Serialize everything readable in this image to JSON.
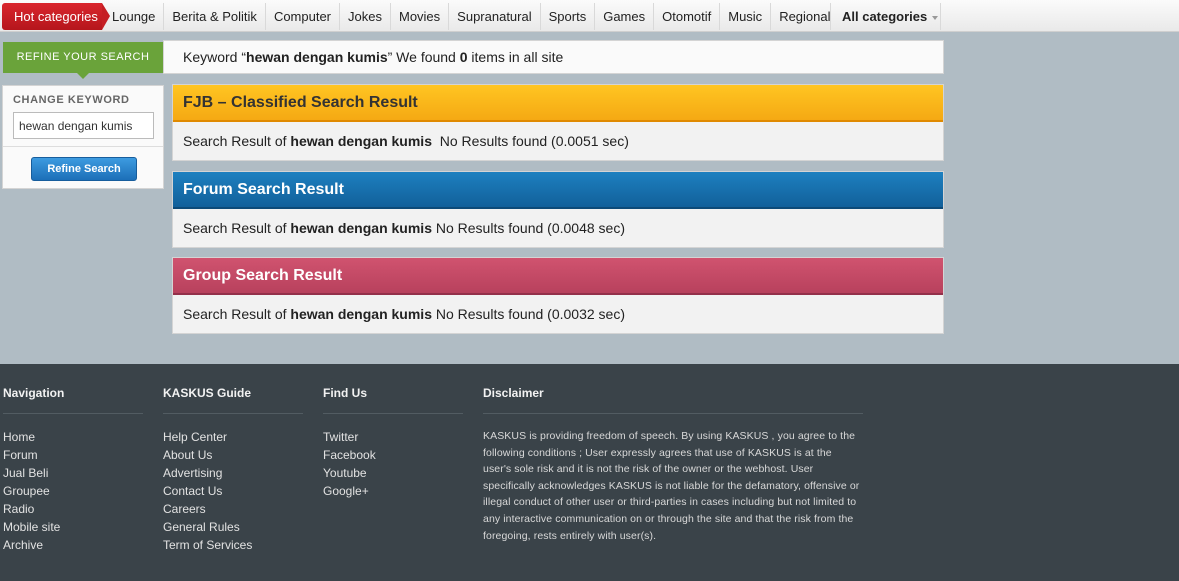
{
  "nav": {
    "hot_label": "Hot categories",
    "items": [
      "Lounge",
      "Berita & Politik",
      "Computer",
      "Jokes",
      "Movies",
      "Supranatural",
      "Sports",
      "Games",
      "Otomotif",
      "Music",
      "Regional"
    ],
    "all_categories": "All categories"
  },
  "refine": {
    "tab_label": "REFINE YOUR SEARCH",
    "change_label": "CHANGE KEYWORD",
    "keyword_value": "hewan dengan kumis",
    "button_label": "Refine Search"
  },
  "summary": {
    "prefix": "Keyword “",
    "keyword": "hewan dengan kumis",
    "middle": "” We found ",
    "count": "0",
    "suffix": " items in all site"
  },
  "panels": [
    {
      "title": "FJB – Classified Search Result",
      "prefix": "Search Result of ",
      "keyword": "hewan dengan kumis",
      "status": "  No Results found (0.0051 sec)"
    },
    {
      "title": "Forum Search Result",
      "prefix": "Search Result of ",
      "keyword": "hewan dengan kumis",
      "status": " No Results found (0.0048 sec)"
    },
    {
      "title": "Group Search Result",
      "prefix": "Search Result of ",
      "keyword": "hewan dengan kumis",
      "status": " No Results found (0.0032 sec)"
    }
  ],
  "footer": {
    "navigation": {
      "title": "Navigation",
      "links": [
        "Home",
        "Forum",
        "Jual Beli",
        "Groupee",
        "Radio",
        "Mobile site",
        "Archive"
      ]
    },
    "guide": {
      "title": "KASKUS Guide",
      "links": [
        "Help Center",
        "About Us",
        "Advertising",
        "Contact Us",
        "Careers",
        "General Rules",
        "Term of Services"
      ]
    },
    "find_us": {
      "title": "Find Us",
      "links": [
        "Twitter",
        "Facebook",
        "Youtube",
        "Google+"
      ]
    },
    "disclaimer": {
      "title": "Disclaimer",
      "text": "KASKUS is providing freedom of speech. By using KASKUS , you agree to the following conditions ; User expressly agrees that use of KASKUS is at the user's sole risk and it is not the risk of the owner or the webhost. User specifically acknowledges KASKUS is not liable for the defamatory, offensive or illegal conduct of other user or third-parties in cases including but not limited to any interactive communication on or through the site and that the risk from the foregoing, rests entirely with user(s)."
    }
  },
  "colors": {
    "hot_red": "#c51e24",
    "refine_green": "#6aa33a",
    "fjb_yellow": "#f5a913",
    "forum_blue": "#1570ad",
    "group_pink": "#c44a66",
    "footer_bg": "#3a4349",
    "page_bg": "#b0bcc4"
  }
}
